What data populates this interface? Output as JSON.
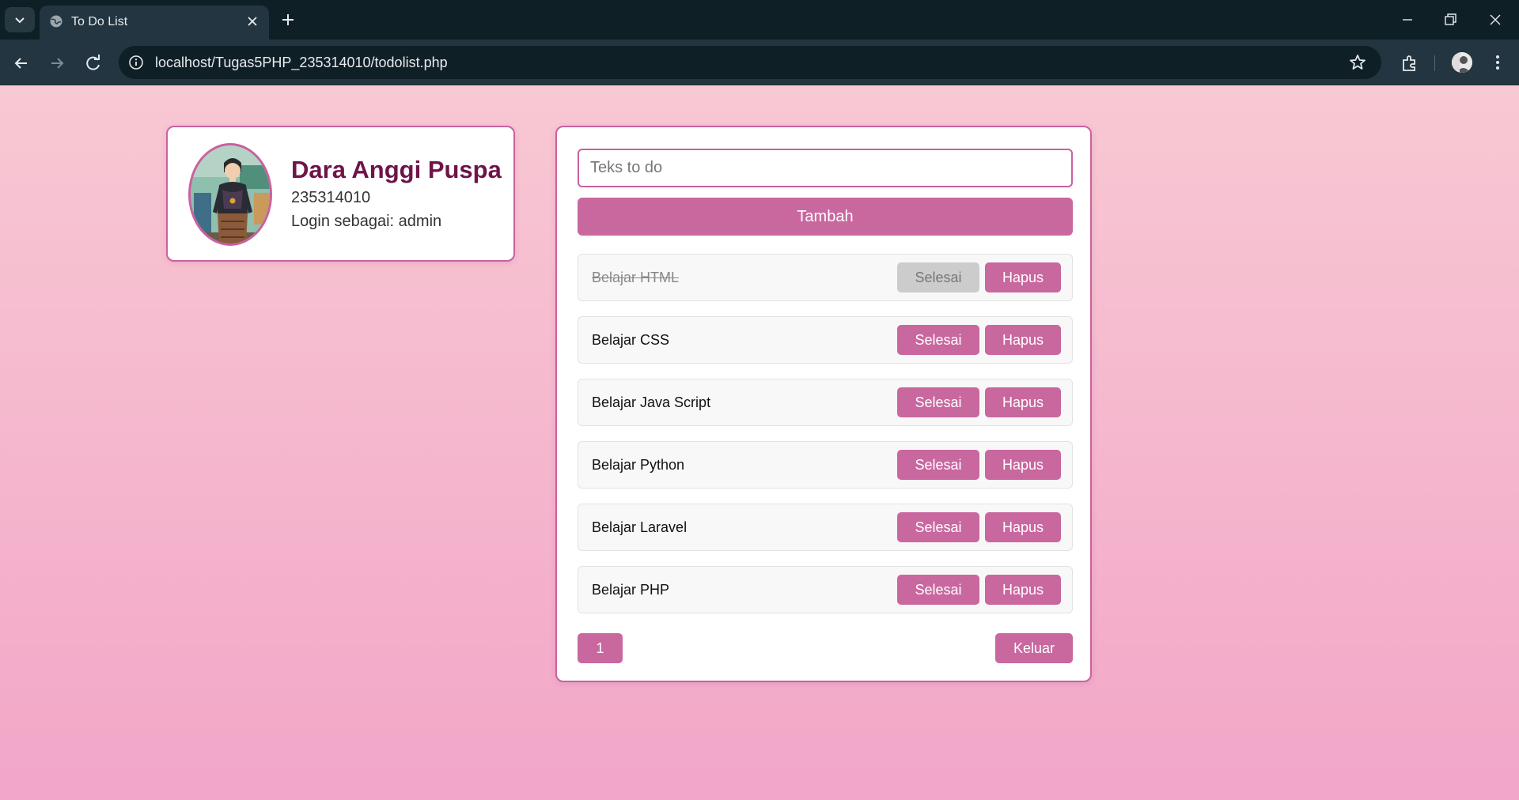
{
  "browser": {
    "tab_title": "To Do List",
    "url": "localhost/Tugas5PHP_235314010/todolist.php",
    "icons": {
      "tab_list": "chevron-down-icon",
      "favicon": "globe-icon",
      "tab_close": "close-icon",
      "new_tab": "plus-icon",
      "back": "back-arrow-icon",
      "forward": "forward-arrow-icon",
      "reload": "reload-icon",
      "site_info": "info-icon",
      "bookmark": "star-icon",
      "extensions": "puzzle-icon",
      "menu": "more-vertical-icon"
    }
  },
  "profile": {
    "name": "Dara Anggi Puspa",
    "nim": "235314010",
    "role": "Login sebagai: admin"
  },
  "todo": {
    "input_placeholder": "Teks to do",
    "add_label": "Tambah",
    "items": [
      {
        "text": "Belajar HTML",
        "done": true,
        "done_label": "Selesai",
        "delete_label": "Hapus"
      },
      {
        "text": "Belajar CSS",
        "done": false,
        "done_label": "Selesai",
        "delete_label": "Hapus"
      },
      {
        "text": "Belajar Java Script",
        "done": false,
        "done_label": "Selesai",
        "delete_label": "Hapus"
      },
      {
        "text": "Belajar Python",
        "done": false,
        "done_label": "Selesai",
        "delete_label": "Hapus"
      },
      {
        "text": "Belajar Laravel",
        "done": false,
        "done_label": "Selesai",
        "delete_label": "Hapus"
      },
      {
        "text": "Belajar PHP",
        "done": false,
        "done_label": "Selesai",
        "delete_label": "Hapus"
      }
    ],
    "page_number": "1",
    "logout_label": "Keluar"
  },
  "colors": {
    "accent": "#c9679f",
    "card_border": "#c9619f",
    "name_color": "#6e1448",
    "bg_top": "#f8c8d3",
    "bg_bottom": "#f2a6c8"
  }
}
